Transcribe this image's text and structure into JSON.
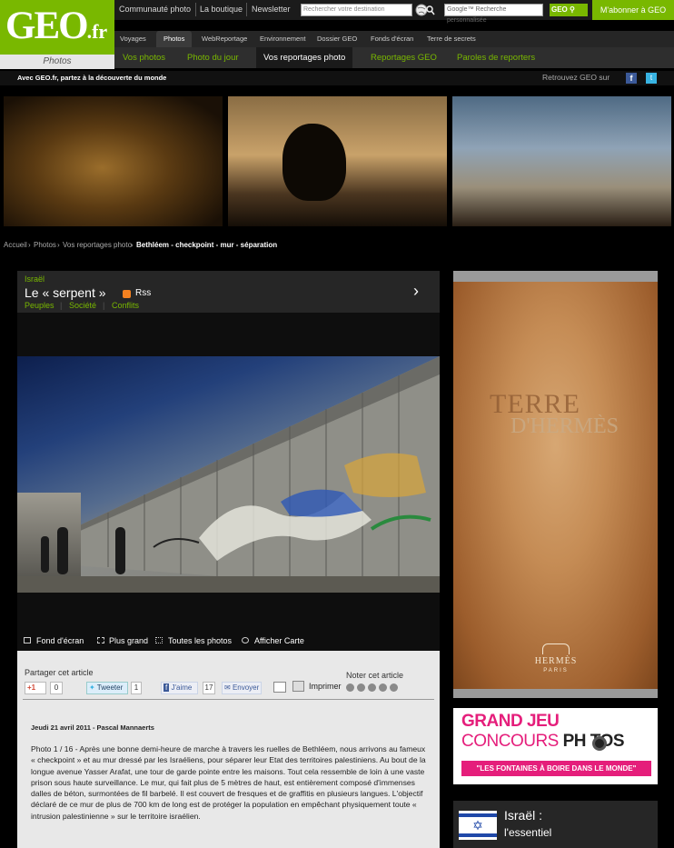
{
  "header": {
    "logo": "GEO",
    "logo_tld": ".fr",
    "logo_sub": "Photos",
    "top_links": [
      "Communauté photo",
      "La boutique",
      "Newsletter"
    ],
    "destination_placeholder": "Rechercher votre destination",
    "google_placeholder": "Google™ Recherche personnalisée",
    "geo_search_label": "GEO",
    "subscribe_label": "M'abonner à GEO",
    "nav_primary": [
      "Voyages",
      "Photos",
      "WebReportage",
      "Environnement",
      "Dossier GEO",
      "Fonds d'écran",
      "Terre de secrets"
    ],
    "nav_secondary": [
      "Vos photos",
      "Photo du jour",
      "Vos reportages photo",
      "Reportages GEO",
      "Paroles de reporters"
    ],
    "tagline": "Avec GEO.fr, partez à la découverte du monde",
    "follow_label": "Retrouvez GEO sur"
  },
  "breadcrumb": [
    "Accueil",
    "Photos",
    "Vos reportages photo",
    "Bethléem - checkpoint - mur - séparation"
  ],
  "article": {
    "country": "Israël",
    "title": "Le « serpent »",
    "rss": "Rss",
    "tags": [
      "Peuples",
      "Société",
      "Conflits"
    ],
    "photo_tools": [
      "Fond d'écran",
      "Plus grand",
      "Toutes les photos",
      "Afficher Carte"
    ],
    "share_label": "Partager cet article",
    "rate_label": "Noter cet article",
    "gplus_label": "+1",
    "gplus_count": "0",
    "tweet_label": "Tweeter",
    "tweet_count": "1",
    "like_label": "J'aime",
    "like_count": "17",
    "send_label": "Envoyer",
    "print_label": "Imprimer",
    "rating_stars": 5,
    "byline": "Jeudi 21 avril 2011 - Pascal Mannaerts",
    "body": "Photo 1 / 16 - Après une bonne demi-heure de marche à travers les ruelles de Bethléem, nous arrivons au fameux « checkpoint » et au mur dressé par les Israéliens, pour séparer leur Etat des territoires palestiniens. Au bout de la longue avenue Yasser Arafat, une tour de garde pointe entre les maisons. Tout cela ressemble de loin à une vaste prison sous haute surveillance. Le mur, qui fait plus de 5 mètres de haut, est entièrement composé d'immenses dalles de béton, surmontées de fil barbelé. Il est couvert de fresques et de graffitis en plusieurs langues. L'objectif déclaré de ce mur de plus de 700 km de long est de protéger la population en empêchant physiquement toute « intrusion palestinienne » sur le territoire israélien."
  },
  "ads": {
    "hermes_line1": "TERRE",
    "hermes_line2": "D'HERMÈS",
    "hermes_brand": "HERMÈS",
    "hermes_city": "PARIS",
    "contest_line1": "GRAND JEU",
    "contest_line2a": "CONCOURS ",
    "contest_line2b": "PH TOS",
    "contest_line3": "\"LES FONTAINES À BOIRE DANS LE MONDE\""
  },
  "sidebar": {
    "country_title": "Israël :",
    "country_sub": "l'essentiel"
  },
  "colors": {
    "brand_green": "#79b800",
    "contest_pink": "#e51e7b"
  }
}
